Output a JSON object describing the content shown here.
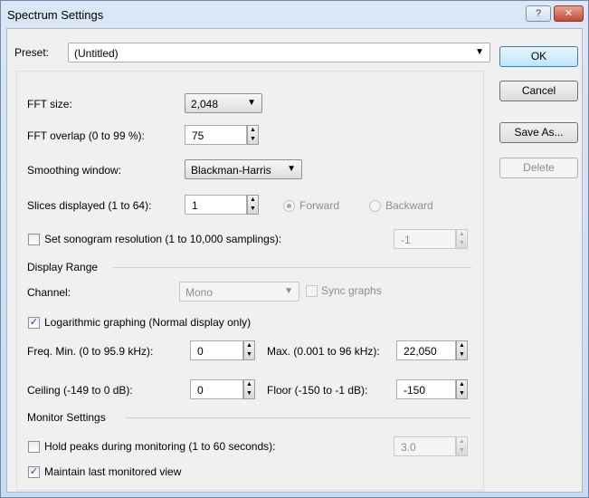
{
  "window": {
    "title": "Spectrum Settings",
    "help_glyph": "?",
    "close_glyph": "✕"
  },
  "preset": {
    "label": "Preset:",
    "value": "(Untitled)"
  },
  "buttons": {
    "ok": "OK",
    "cancel": "Cancel",
    "save_as": "Save As...",
    "delete": "Delete"
  },
  "fft": {
    "size_label": "FFT size:",
    "size_value": "2,048",
    "overlap_label": "FFT overlap (0 to 99 %):",
    "overlap_value": "75"
  },
  "smoothing": {
    "label": "Smoothing window:",
    "value": "Blackman-Harris"
  },
  "slices": {
    "label": "Slices displayed (1 to 64):",
    "value": "1",
    "forward_label": "Forward",
    "backward_label": "Backward",
    "selected": "Forward"
  },
  "sonogram": {
    "label": "Set sonogram resolution (1 to 10,000 samplings):",
    "value": "-1",
    "checked": false
  },
  "display_range": {
    "heading": "Display Range",
    "channel_label": "Channel:",
    "channel_value": "Mono",
    "sync_label": "Sync graphs",
    "sync_checked": false,
    "log_label": "Logarithmic graphing (Normal display only)",
    "log_checked": true,
    "freq_min_label": "Freq. Min. (0 to 95.9 kHz):",
    "freq_min_value": "0",
    "freq_max_label": "Max. (0.001 to 96 kHz):",
    "freq_max_value": "22,050",
    "ceiling_label": "Ceiling (-149 to 0 dB):",
    "ceiling_value": "0",
    "floor_label": "Floor (-150 to -1 dB):",
    "floor_value": "-150"
  },
  "monitor": {
    "heading": "Monitor Settings",
    "hold_label": "Hold peaks during monitoring (1 to 60 seconds):",
    "hold_value": "3.0",
    "hold_checked": false,
    "maintain_label": "Maintain last monitored view",
    "maintain_checked": true
  },
  "glyphs": {
    "dropdown": "▼",
    "spin_up": "▲",
    "spin_down": "▼",
    "check": "✓"
  }
}
